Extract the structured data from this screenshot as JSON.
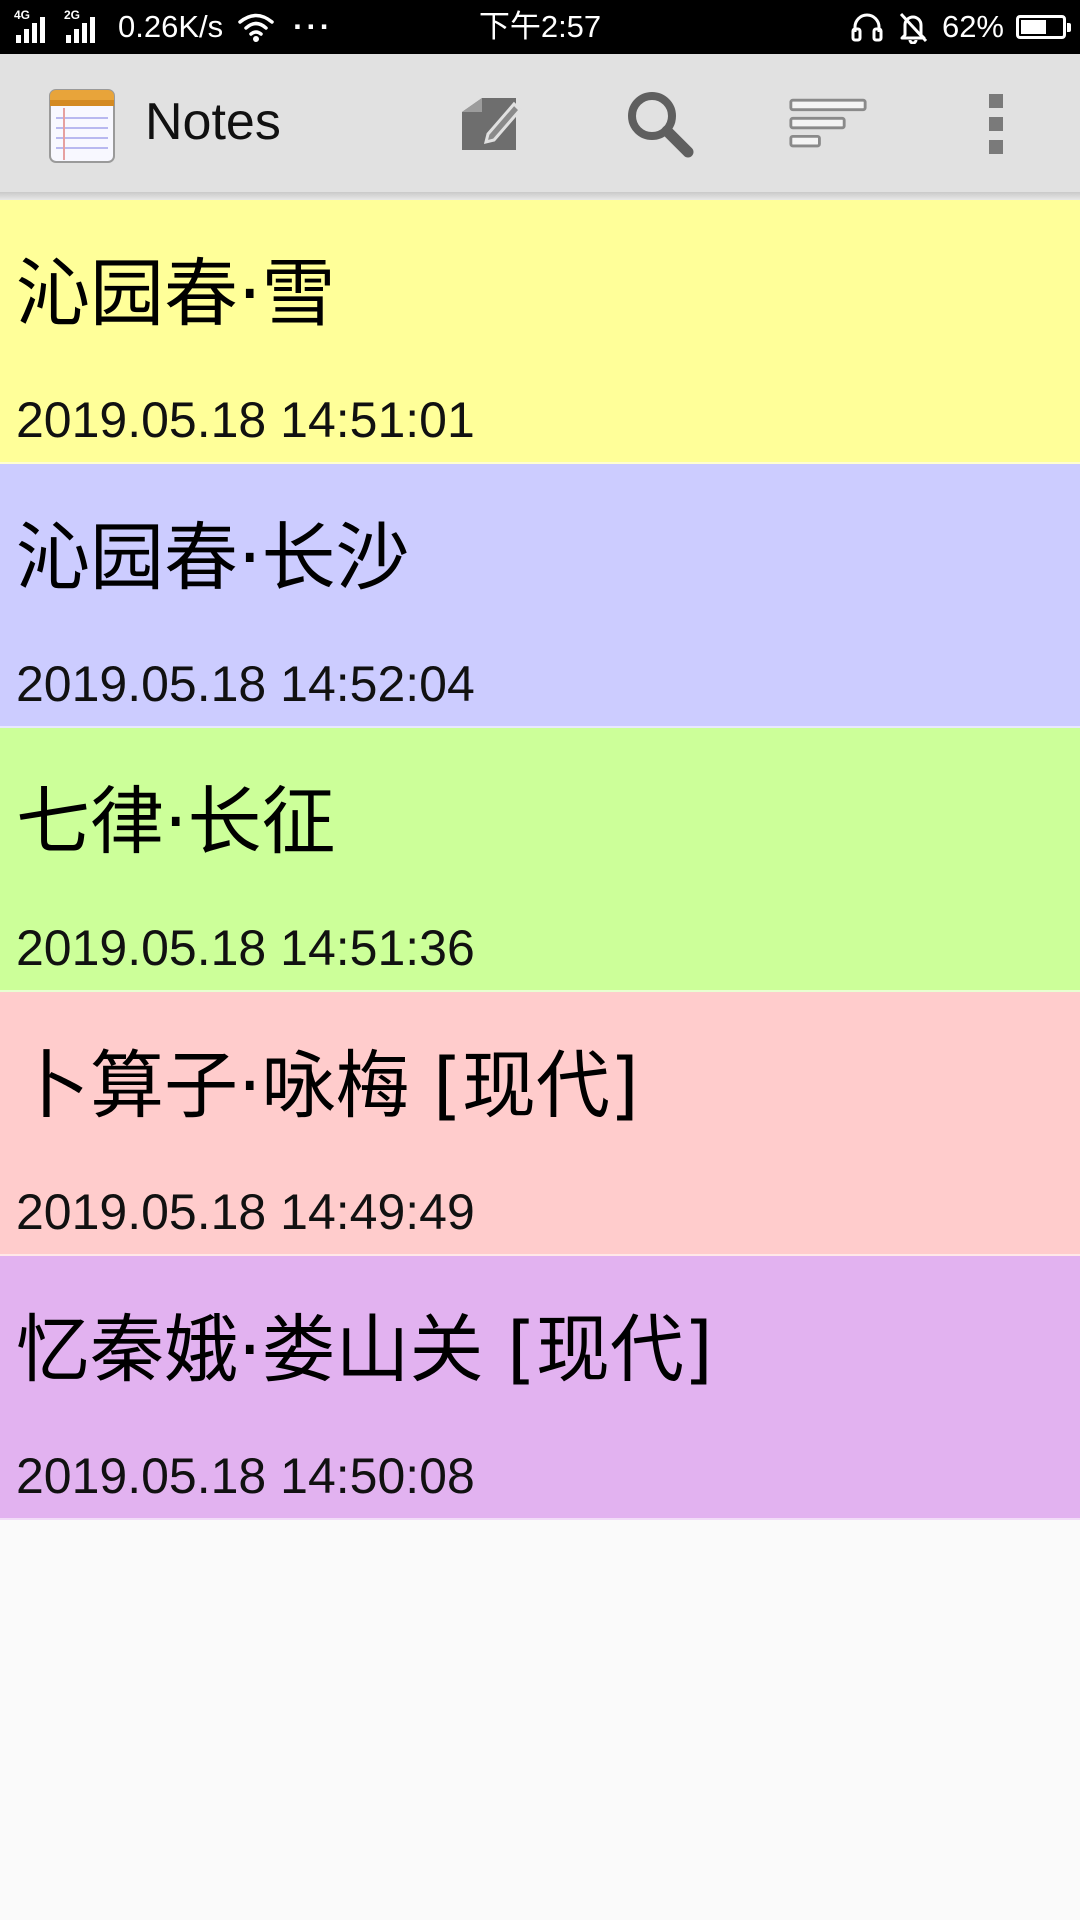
{
  "status_bar": {
    "network_1": "4G",
    "network_2": "2G",
    "speed": "0.26K/s",
    "more": "···",
    "time": "下午2:57",
    "battery_percent": 62,
    "battery_text": "62%"
  },
  "action_bar": {
    "title": "Notes",
    "icons": [
      "notepad-app-icon",
      "new-note-icon",
      "search-icon",
      "sort-icon",
      "overflow-menu-icon"
    ]
  },
  "notes": [
    {
      "title": "沁园春·雪",
      "date": "2019.05.18 14:51:01",
      "color": "#ffff99"
    },
    {
      "title": "沁园春·长沙",
      "date": "2019.05.18 14:52:04",
      "color": "#ccccff"
    },
    {
      "title": "七律·长征",
      "date": "2019.05.18 14:51:36",
      "color": "#ccff99"
    },
    {
      "title": "卜算子·咏梅 [现代]",
      "date": "2019.05.18 14:49:49",
      "color": "#ffcccc"
    },
    {
      "title": "忆秦娥·娄山关 [现代]",
      "date": "2019.05.18 14:50:08",
      "color": "#e2b2f0"
    }
  ],
  "colors": {
    "status_bar_bg": "#000000",
    "action_bar_bg": "#e1e1e1",
    "page_bg": "#fafafa"
  }
}
